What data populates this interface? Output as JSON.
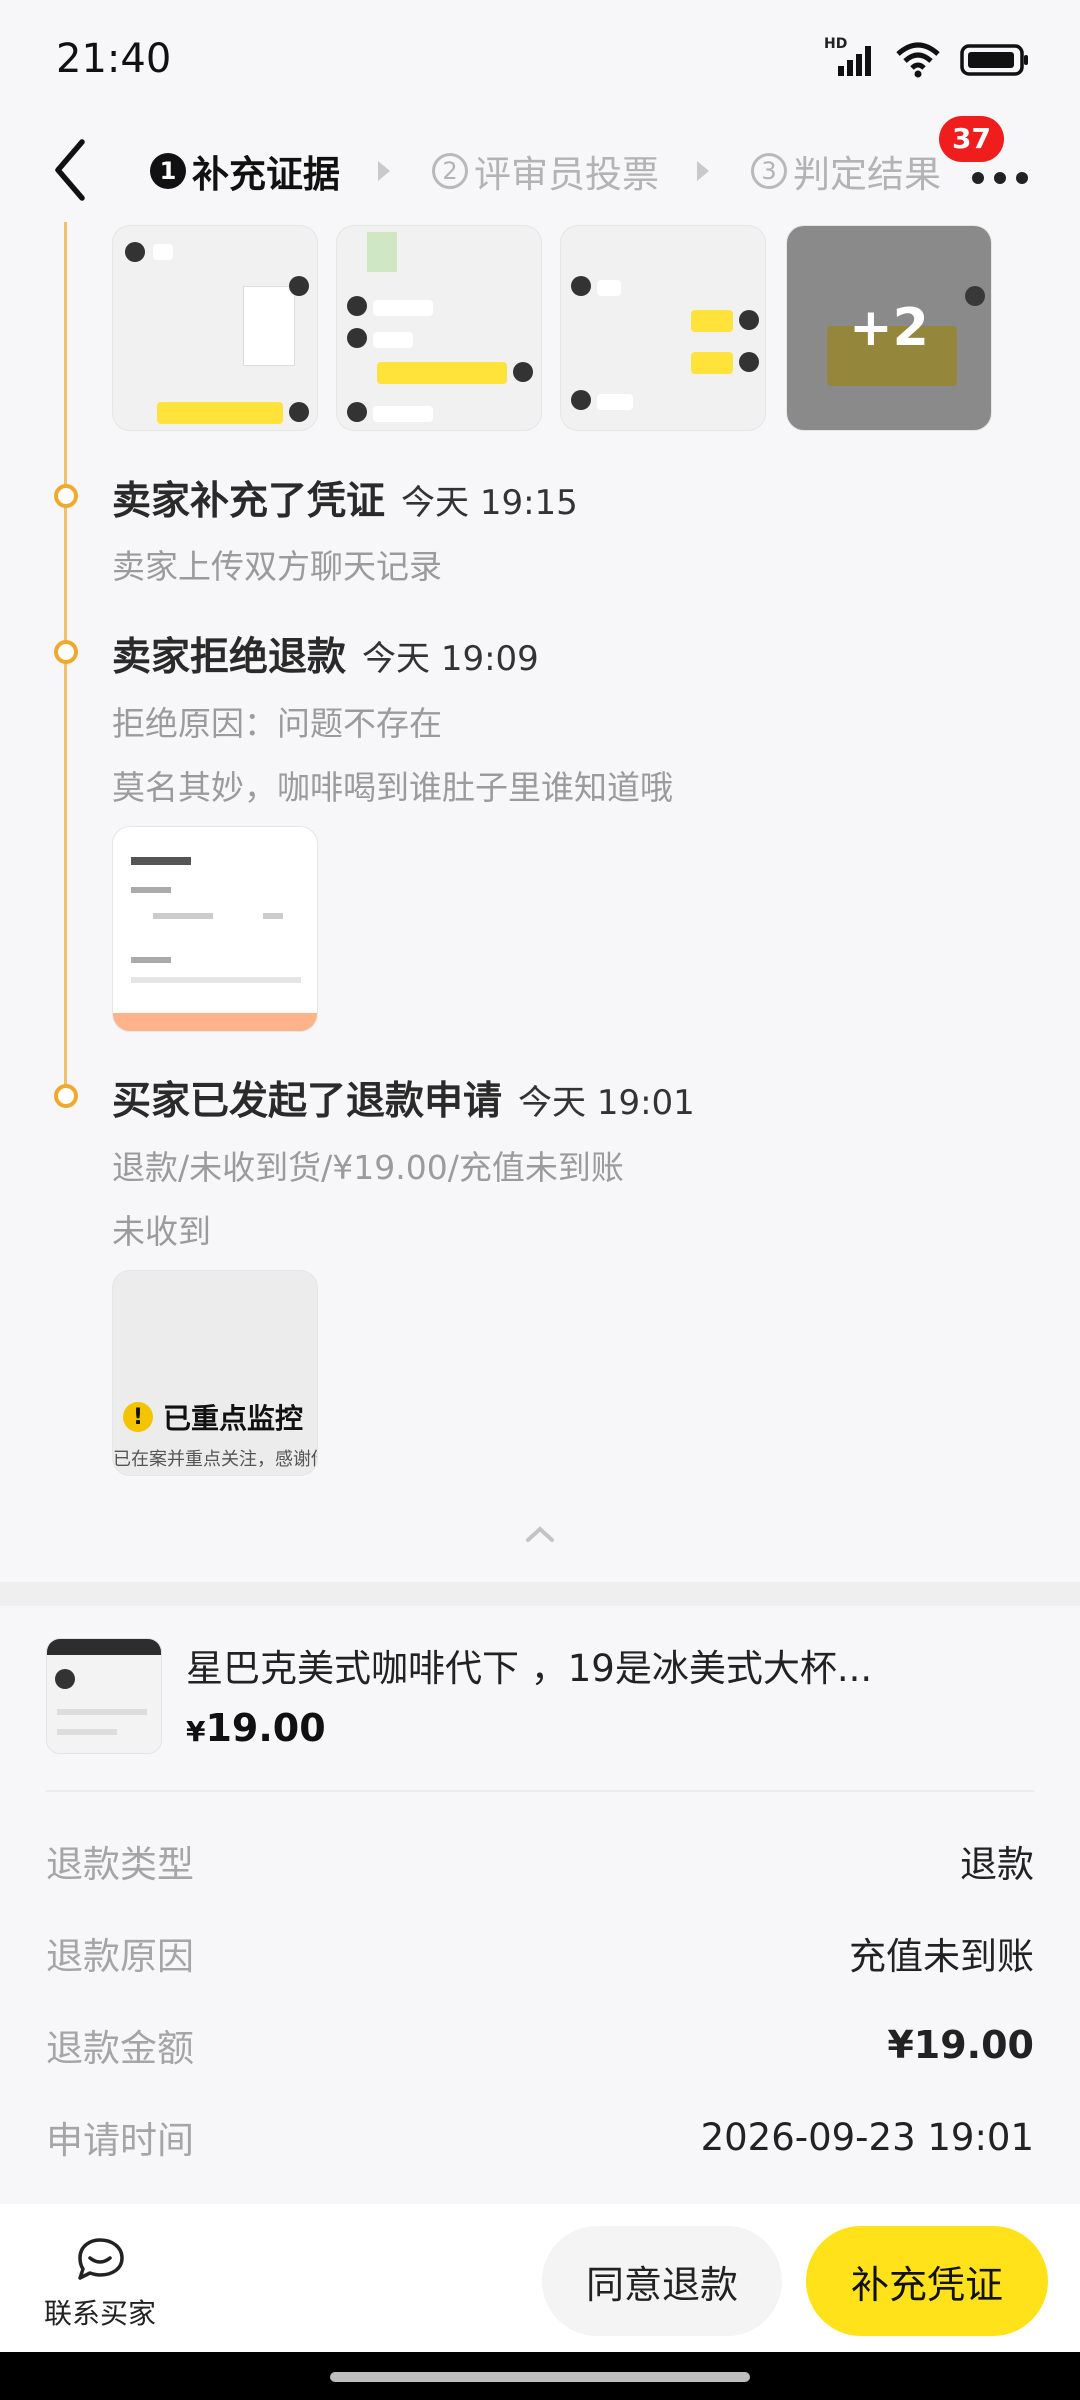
{
  "status_bar": {
    "time": "21:40",
    "network_label": "HD"
  },
  "nav": {
    "steps": [
      {
        "num": "1",
        "label": "补充证据"
      },
      {
        "num": "2",
        "label": "评审员投票"
      },
      {
        "num": "3",
        "label": "判定结果"
      }
    ],
    "badge_count": "37"
  },
  "evidence": {
    "more_count": "+2"
  },
  "timeline": [
    {
      "title": "卖家补充了凭证",
      "time": "今天 19:15",
      "lines": [
        "卖家上传双方聊天记录"
      ]
    },
    {
      "title": "卖家拒绝退款",
      "time": "今天 19:09",
      "lines": [
        "拒绝原因：问题不存在",
        "莫名其妙，咖啡喝到谁肚子里谁知道哦"
      ]
    },
    {
      "title": "买家已发起了退款申请",
      "time": "今天 19:01",
      "lines": [
        "退款/未收到货/¥19.00/充值未到账",
        "未收到"
      ]
    }
  ],
  "monitor_card": {
    "label": "已重点监控",
    "sub": "已在案并重点关注，感谢你"
  },
  "product": {
    "title": "星巴克美式咖啡代下 ，19是冰美式大杯...",
    "currency": "¥",
    "price": "19.00"
  },
  "info_rows": [
    {
      "label": "退款类型",
      "value": "退款"
    },
    {
      "label": "退款原因",
      "value": "充值未到账"
    },
    {
      "label": "退款金额",
      "value": "¥19.00"
    },
    {
      "label": "申请时间",
      "value": "2026-09-23 19:01"
    }
  ],
  "bottom": {
    "contact_label": "联系买家",
    "agree_label": "同意退款",
    "supplement_label": "补充凭证"
  }
}
